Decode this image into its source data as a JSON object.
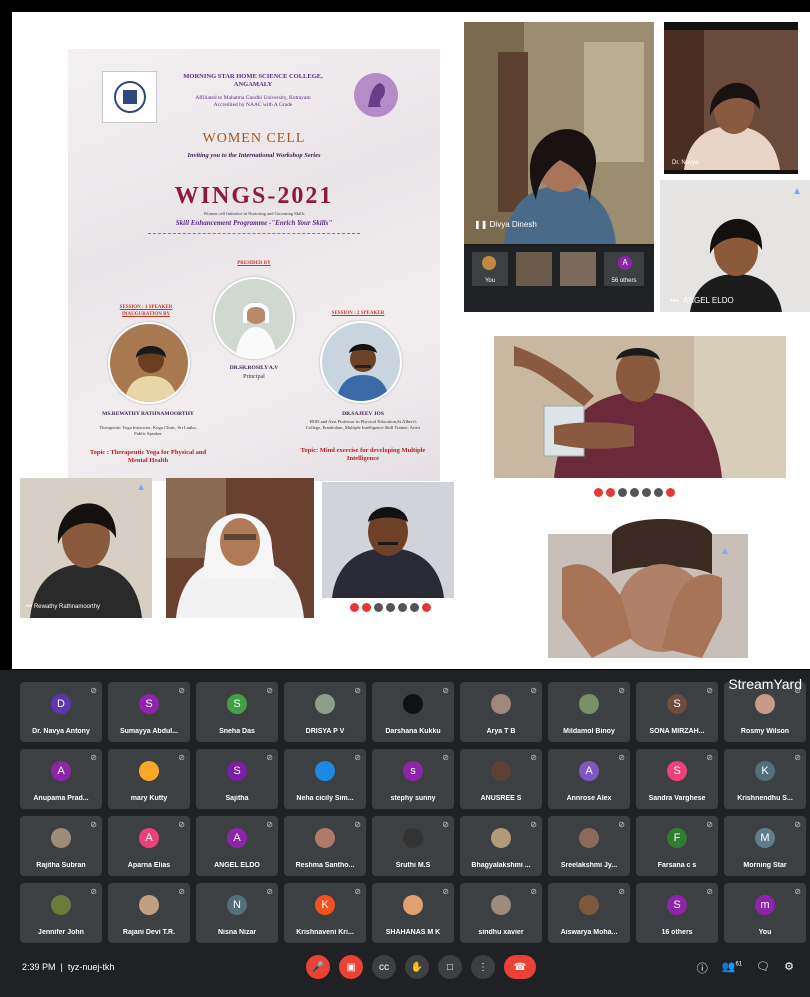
{
  "poster": {
    "college": "MORNING STAR HOME SCIENCE COLLEGE, ANGAMALY",
    "affiliation": "Affiliated to Mahatma Gandhi University, Kottayam",
    "accreditation": "Accredited by NAAC with A Grade",
    "cell": "WOMEN CELL",
    "invite": "Inviting you to the International Workshop Series",
    "title": "WINGS-2021",
    "subtitle": "Women cell Initiative in Nurturing and Grooming Skills",
    "programme": "Skill Enhancement Programme -\"Enrich Your Skills\"",
    "presided_label": "PRESIDED BY",
    "presider_name": "DR.SR.ROSILY A.V",
    "presider_role": "Principal",
    "session1_label": "SESSION : 1 SPEAKER",
    "inauguration_label": "INAUGURATION BY",
    "speaker1_name": "MS.REWATHY RATHNAMOORTHY",
    "speaker1_desc": "Therapeutic Yoga Instructor, Koga Clinic, Sri Lanka, Public Speaker",
    "speaker1_topic": "Topic : Therapeutic Yoga for Physical and Mental Health",
    "session2_label": "SESSION : 2 SPEAKER",
    "speaker2_name": "DR.SAJEEV JOS",
    "speaker2_desc": "HOD and Asst.Professor in Physical Education,St.Albert's College, Ernakulam, Multiple Intelligence Skill Trainer, Artist",
    "speaker2_topic": "Topic: Mind exercise for developing Multiple Intelligence"
  },
  "tiles": {
    "divya": "Divya Dinesh",
    "angel": "ANGEL ELDO",
    "you": "You",
    "others_small": "56 others",
    "rewathy": "Rewathy Rathnamoorthy",
    "navya_small": "Dr. Navya"
  },
  "participants": [
    {
      "name": "Dr. Navya Antony",
      "initial": "D",
      "color": "#5e35b1"
    },
    {
      "name": "Sumayya Abdul...",
      "initial": "S",
      "color": "#8e24aa"
    },
    {
      "name": "Sneha Das",
      "initial": "S",
      "color": "#43a047"
    },
    {
      "name": "DRISYA P V",
      "initial": "",
      "color": "#8d9f8a"
    },
    {
      "name": "Darshana Kukku",
      "initial": "",
      "color": "#111111"
    },
    {
      "name": "Arya T B",
      "initial": "",
      "color": "#a1887f"
    },
    {
      "name": "Mildamol Binoy",
      "initial": "",
      "color": "#7a8f6a"
    },
    {
      "name": "SONA MIRZAH...",
      "initial": "S",
      "color": "#6d4c41"
    },
    {
      "name": "Rosmy Wilson",
      "initial": "",
      "color": "#c79b8a"
    },
    {
      "name": "Anupama Prad...",
      "initial": "A",
      "color": "#8e24aa"
    },
    {
      "name": "mary Kutty",
      "initial": "",
      "color": "#f9a825"
    },
    {
      "name": "Sajitha",
      "initial": "S",
      "color": "#7b1fa2"
    },
    {
      "name": "Neha cicily Sim...",
      "initial": "",
      "color": "#1e88e5"
    },
    {
      "name": "stephy sunny",
      "initial": "s",
      "color": "#8e24aa"
    },
    {
      "name": "ANUSREE S",
      "initial": "",
      "color": "#5d4037"
    },
    {
      "name": "Annrose Alex",
      "initial": "A",
      "color": "#7e57c2"
    },
    {
      "name": "Sandra Varghese",
      "initial": "S",
      "color": "#ec407a"
    },
    {
      "name": "Krishnendhu S...",
      "initial": "K",
      "color": "#546e7a"
    },
    {
      "name": "Rajitha Subran",
      "initial": "",
      "color": "#9e8c7a"
    },
    {
      "name": "Aparna Elias",
      "initial": "A",
      "color": "#ec407a"
    },
    {
      "name": "ANGEL ELDO",
      "initial": "A",
      "color": "#8e24aa"
    },
    {
      "name": "Reshma Santho...",
      "initial": "",
      "color": "#b07a6a"
    },
    {
      "name": "Sruthi M.S",
      "initial": "",
      "color": "#333333"
    },
    {
      "name": "Bhagyalakshmi ...",
      "initial": "",
      "color": "#b39b7a"
    },
    {
      "name": "Sreelakshmi Jy...",
      "initial": "",
      "color": "#8a6a5a"
    },
    {
      "name": "Farsana c s",
      "initial": "F",
      "color": "#2e7d32"
    },
    {
      "name": "Morning Star",
      "initial": "M",
      "color": "#607d8b"
    },
    {
      "name": "Jennifer John",
      "initial": "",
      "color": "#6b7b3a"
    },
    {
      "name": "Rajani Devi T.R.",
      "initial": "",
      "color": "#c0a080"
    },
    {
      "name": "Nisna Nizar",
      "initial": "N",
      "color": "#546e7a"
    },
    {
      "name": "Krishnaveni Kri...",
      "initial": "K",
      "color": "#f4511e"
    },
    {
      "name": "SHAHANAS M K",
      "initial": "",
      "color": "#e0a070"
    },
    {
      "name": "sindhu xavier",
      "initial": "",
      "color": "#a08a7a"
    },
    {
      "name": "Aiswarya Moha...",
      "initial": "",
      "color": "#7a5a3a"
    },
    {
      "name": "16 others",
      "initial": "S",
      "color": "#8e24aa"
    },
    {
      "name": "You",
      "initial": "m",
      "color": "#8e24aa"
    }
  ],
  "streamyard": "StreamYard",
  "meeting": {
    "time": "2:39 PM",
    "code": "tyz-nuej-tkh",
    "people_count": "61"
  }
}
